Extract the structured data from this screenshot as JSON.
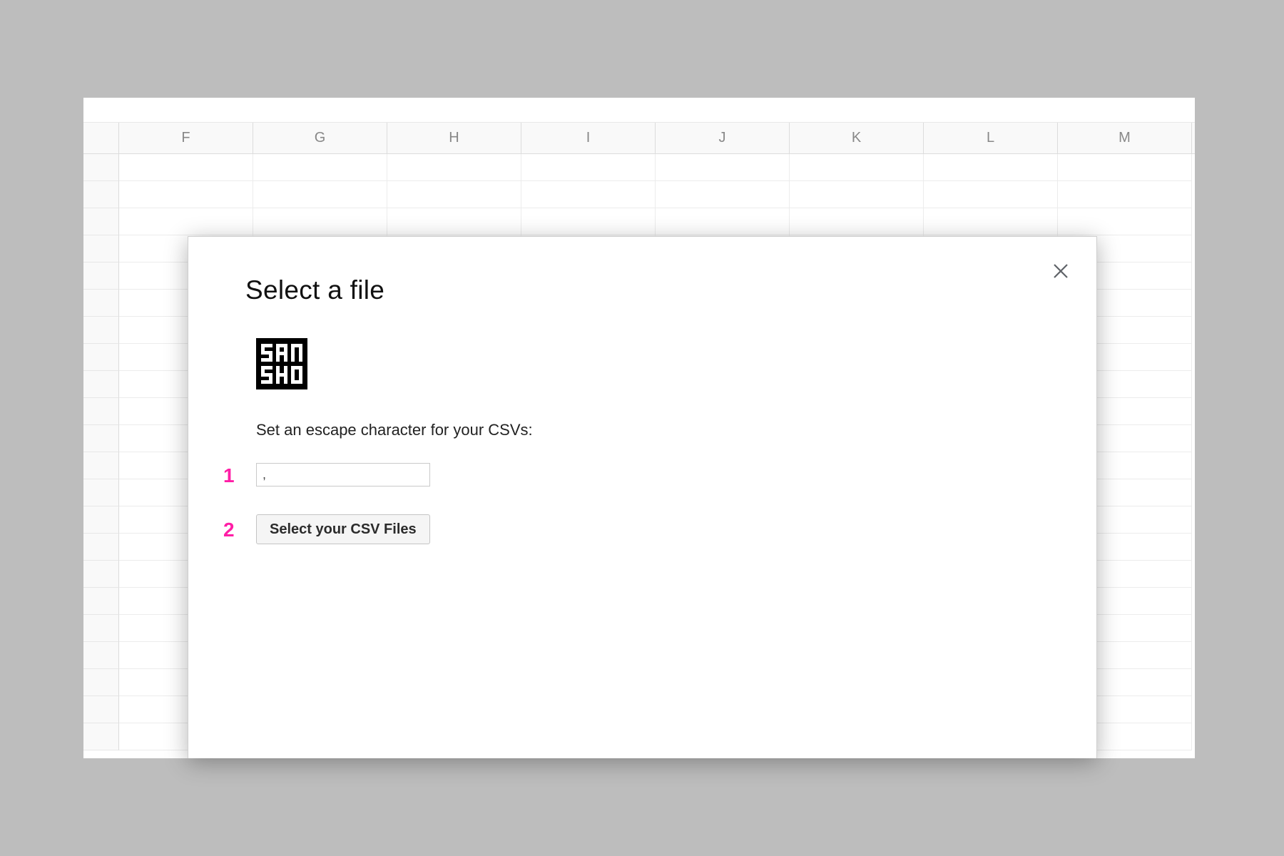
{
  "spreadsheet": {
    "columns": [
      "F",
      "G",
      "H",
      "I",
      "J",
      "K",
      "L",
      "M"
    ]
  },
  "modal": {
    "title": "Select a file",
    "instruction": "Set an escape character for your CSVs:",
    "escape_char_value": ",",
    "select_files_label": "Select your CSV Files",
    "logo_alt": "sansho"
  },
  "annotations": {
    "step1": "1",
    "step2": "2"
  },
  "colors": {
    "annotation": "#ff1ea6"
  }
}
